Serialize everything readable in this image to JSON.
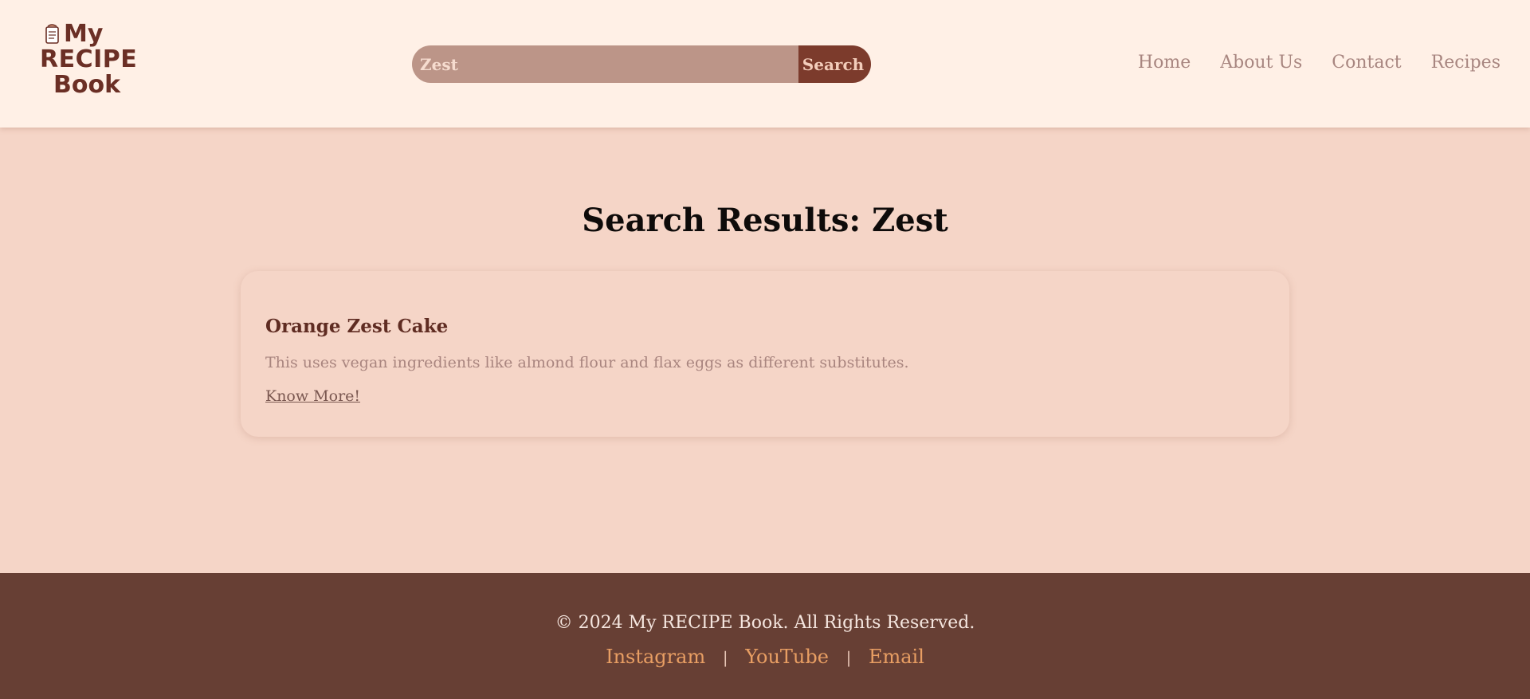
{
  "header": {
    "logo": {
      "line1": "My",
      "line2": "RECIPE",
      "line3": "Book",
      "icon": "recipe-book-icon"
    },
    "search": {
      "value": "Zest",
      "placeholder": "Search",
      "button_label": "Search"
    },
    "nav": [
      "Home",
      "About Us",
      "Contact",
      "Recipes"
    ]
  },
  "main": {
    "title": "Search Results: Zest",
    "results": [
      {
        "title": "Orange Zest Cake",
        "description": "This uses vegan ingredients like almond flour and flax eggs as different substitutes.",
        "link_label": "Know More!"
      }
    ]
  },
  "footer": {
    "copyright": "© 2024 My RECIPE Book. All Rights Reserved.",
    "links": [
      "Instagram",
      "YouTube",
      "Email"
    ],
    "separator": "|"
  },
  "colors": {
    "header_bg": "#fff0e6",
    "page_bg": "#f5d5c7",
    "brand": "#6b2f25",
    "search_bg": "#bc9588",
    "search_button": "#7c3b2c",
    "footer_bg": "#673f34",
    "footer_link": "#e89e63"
  }
}
